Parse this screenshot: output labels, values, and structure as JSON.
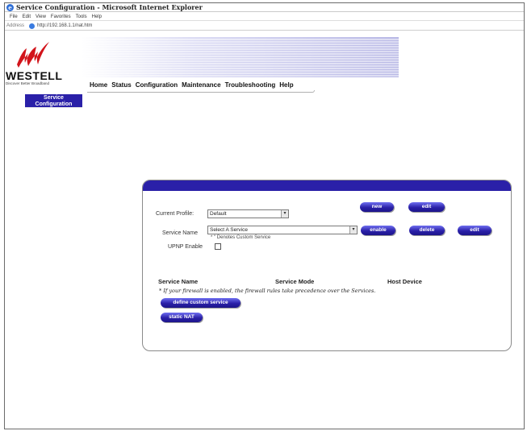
{
  "window": {
    "title": "Service Configuration - Microsoft Internet Explorer",
    "menu": [
      "File",
      "Edit",
      "View",
      "Favorites",
      "Tools",
      "Help"
    ],
    "address_label": "Address",
    "url": "http://192.168.1.1/nat.htm"
  },
  "brand": {
    "name": "WESTELL",
    "tagline": "Discover Better Broadband"
  },
  "nav": {
    "items": [
      "Home",
      "Status",
      "Configuration",
      "Maintenance",
      "Troubleshooting",
      "Help"
    ]
  },
  "sidebar": {
    "active_tab_line1": "Service",
    "active_tab_line2": "Configuration"
  },
  "form": {
    "current_profile_label": "Current Profile:",
    "current_profile_value": "Default",
    "new_label": "new",
    "edit_profile_label": "edit",
    "service_name_label": "Service Name",
    "service_name_value": "Select A Service",
    "custom_note": "* \" Denotes Custom Service",
    "enable_label": "enable",
    "delete_label": "delete",
    "edit_service_label": "edit",
    "upnp_label": "UPNP Enable",
    "upnp_checked": false
  },
  "table": {
    "columns": [
      "Service Name",
      "Service Mode",
      "Host Device"
    ],
    "firewall_note": "* If your firewall is enabled, the firewall rules take precedence over the Services."
  },
  "actions": {
    "define_custom_label": "define custom service",
    "static_nat_label": "static NAT"
  },
  "colors": {
    "accent": "#2a20a8"
  }
}
